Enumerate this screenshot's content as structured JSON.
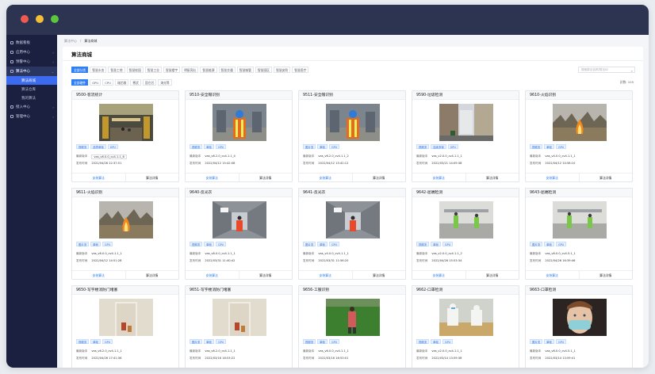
{
  "sidebar": {
    "items": [
      {
        "label": "数据看板",
        "chev": ""
      },
      {
        "label": "应用中心",
        "chev": "›"
      },
      {
        "label": "预警中心",
        "chev": "›"
      },
      {
        "label": "算法中心",
        "chev": "⌄"
      }
    ],
    "subs": [
      {
        "label": "算法商城"
      },
      {
        "label": "算法仓库"
      },
      {
        "label": "我的算法"
      }
    ],
    "more": [
      {
        "label": "接入中心",
        "chev": "›"
      },
      {
        "label": "管理中心",
        "chev": "›"
      }
    ]
  },
  "breadcrumb": {
    "root": "算法中心",
    "sep": "/",
    "current": "算法商城"
  },
  "panel_title": "算法商城",
  "category_tabs": [
    "全部分类",
    "智慧水务",
    "智慧工地",
    "智慧校园",
    "智慧工业",
    "智慧楼宇",
    "明厨亮灶",
    "智慧能源",
    "智慧交通",
    "智慧城管",
    "智慧园区",
    "智慧安防",
    "智慧医疗"
  ],
  "search_placeholder": "搜索算法名称/算法ID",
  "hw_tabs": [
    "全部硬件",
    "GPU",
    "CPU",
    "瑞芯微",
    "寒武",
    "昆仑芯",
    "海光等"
  ],
  "total_label": "总数: 105",
  "actions": {
    "install": "安装算法",
    "detail": "算法详情"
  },
  "meta_labels": {
    "version": "最新版本",
    "time": "发布时间"
  },
  "cards": [
    {
      "title": "9500-客流统计",
      "badges": [
        "视频流",
        "选项单帧",
        "GPU"
      ],
      "version": "vas_v6.0.0_cv4.1.1_6",
      "time": "2022/04/26 22:37:51",
      "select": true,
      "scene": "station"
    },
    {
      "title": "9510-安全帽识别",
      "badges": [
        "视频流",
        "单帧",
        "GPU"
      ],
      "version": "vas_v6.2.0_cv4.1.1_4",
      "time": "2022/04/12 15:42:08",
      "select": false,
      "scene": "worker"
    },
    {
      "title": "9511-安全帽识别",
      "badges": [
        "图片流",
        "单帧",
        "GPU"
      ],
      "version": "vas_v6.2.0_cv4.1.1_2",
      "time": "2022/04/12 15:42:12",
      "select": false,
      "scene": "worker"
    },
    {
      "title": "9590-垃圾检测",
      "badges": [
        "视频流",
        "连续多帧",
        "GPU"
      ],
      "version": "vas_v2.0.0_cv4.1.1_1",
      "time": "2022/03/21 14:09:38",
      "select": false,
      "scene": "street"
    },
    {
      "title": "9610-火焰识别",
      "badges": [
        "视频流",
        "单帧",
        "GPU"
      ],
      "version": "vas_v4.0.0_cv4.1.1_1",
      "time": "2022/04/12 14:58:10",
      "select": false,
      "scene": "fire"
    },
    {
      "title": "9611-火焰识别",
      "badges": [
        "图片流",
        "单帧",
        "GPU"
      ],
      "version": "vas_v6.0.0_cv4.1.1_1",
      "time": "2022/04/12 14:51:28",
      "select": false,
      "scene": "fire"
    },
    {
      "title": "9640-反光衣",
      "badges": [
        "视频流",
        "单帧",
        "GPU"
      ],
      "version": "vas_v6.0.0_cv4.1.1_1",
      "time": "2022/03/31 11:40:42",
      "select": false,
      "scene": "corridor"
    },
    {
      "title": "9641-反光衣",
      "badges": [
        "图片流",
        "单帧",
        "GPU"
      ],
      "version": "vas_v4.0.0_cv4.1.1_1",
      "time": "2022/03/31 11:56:20",
      "select": false,
      "scene": "corridor"
    },
    {
      "title": "9642-屈端检测",
      "badges": [
        "视频流",
        "单帧",
        "GPU"
      ],
      "version": "vas_v2.0.0_cv4.1.1_2",
      "time": "2022/04/26 15:53:34",
      "select": false,
      "scene": "factory"
    },
    {
      "title": "9643-屈端检测",
      "badges": [
        "图片流",
        "单帧",
        "GPU"
      ],
      "version": "vas_v6.0.0_cv4.5.1_1",
      "time": "2022/04/26 16:39:46",
      "select": false,
      "scene": "factory"
    },
    {
      "title": "9650-写字楼消防门堵塞",
      "badges": [
        "视频流",
        "单帧",
        "GPU"
      ],
      "version": "vas_v6.2.0_cv4.1.1_1",
      "time": "2022/04/26 17:41:36",
      "select": false,
      "scene": "door"
    },
    {
      "title": "9651-写字楼消防门堵塞",
      "badges": [
        "图片流",
        "单帧",
        "GPU"
      ],
      "version": "vas_v6.2.0_cv4.1.1_1",
      "time": "2022/03/16 16:53:22",
      "select": false,
      "scene": "door"
    },
    {
      "title": "9656-工服识别",
      "badges": [
        "视频流",
        "单帧",
        "GPU"
      ],
      "version": "vas_v6.0.0_cv4.1.1_1",
      "time": "2022/03/16 16:53:01",
      "select": false,
      "scene": "field"
    },
    {
      "title": "9662-口罩检测",
      "badges": [
        "视频流",
        "单帧",
        "GPU"
      ],
      "version": "vas_v2.0.0_cv4.1.1_1",
      "time": "2022/03/14 13:59:38",
      "select": false,
      "scene": "kitchen"
    },
    {
      "title": "9663-口罩检测",
      "badges": [
        "图片流",
        "单帧",
        "GPU"
      ],
      "version": "vas_v6.0.0_cv4.5.1_1",
      "time": "2022/03/14 13:59:41",
      "select": false,
      "scene": "mask"
    }
  ]
}
